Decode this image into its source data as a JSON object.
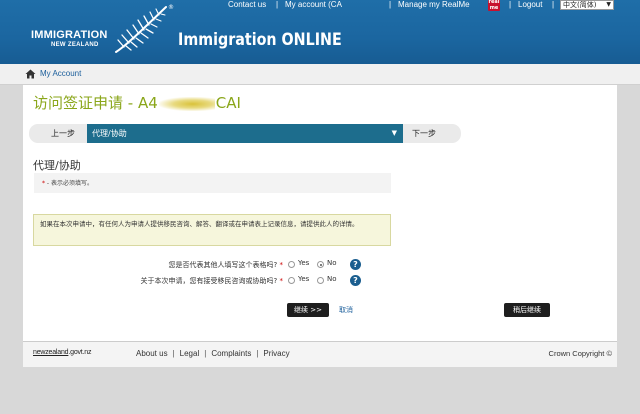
{
  "header": {
    "logo_line1": "IMMIGRATION",
    "logo_line2": "NEW ZEALAND",
    "logo_reg": "®",
    "app_title": "Immigration ONLINE",
    "links": {
      "contact": "Contact us",
      "sep": "|",
      "account": "My account (CA",
      "manage_realme": "Manage my RealMe",
      "logout": "Logout"
    },
    "realme_badge": "real me",
    "language_select": "中文(简体)"
  },
  "subnav": {
    "my_account": "My Account"
  },
  "page": {
    "title_prefix": "访问签证申请 - A4",
    "title_suffix": "CAI"
  },
  "stepbar": {
    "prev_label": "上一步",
    "current_step": "代理/协助",
    "next_label": "下一步"
  },
  "section": {
    "title": "代理/协助",
    "required_star": "*",
    "required_note": " - 表示必须填写。"
  },
  "info": {
    "text": "如果在本次申请中，有任何人为申请人提供移民咨询、解答、翻译或在申请表上记录信息，请提供此人的详情。"
  },
  "questions": [
    {
      "label": "您是否代表其他人填写这个表格吗?",
      "star": "*",
      "yes": "Yes",
      "no": "No",
      "selected": "No"
    },
    {
      "label": "关于本次申请，您有接受移民咨询或协助吗?",
      "star": "*",
      "yes": "Yes",
      "no": "No",
      "selected": ""
    }
  ],
  "actions": {
    "continue": "继续 >>",
    "cancel": "取消",
    "save_continue": "稍后继续"
  },
  "footer": {
    "govt_logo_a": "newzealand",
    "govt_logo_b": ".govt.nz",
    "about": "About us",
    "legal": "Legal",
    "complaints": "Complaints",
    "privacy": "Privacy",
    "sep": "|",
    "copyright": "Crown Copyright ©"
  },
  "colors": {
    "header_blue": "#1b66a0",
    "title_green": "#8aa61a",
    "step_teal": "#1d6d8d",
    "button_dark": "#1e1e1e"
  }
}
